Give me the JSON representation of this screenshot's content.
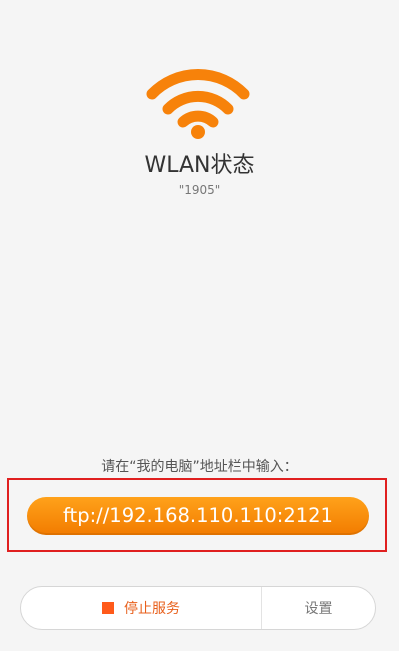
{
  "status": {
    "title": "WLAN状态",
    "ssid": "\"1905\""
  },
  "instruction": "请在“我的电脑”地址栏中输入：",
  "ftp_address": "ftp://192.168.110.110:2121",
  "controls": {
    "stop_label": "停止服务",
    "settings_label": "设置"
  },
  "icons": {
    "wifi": "wifi-icon",
    "stop": "stop-square-icon"
  },
  "colors": {
    "accent": "#f7820a",
    "highlight_border": "#e02020",
    "stop_text": "#e8601c"
  }
}
